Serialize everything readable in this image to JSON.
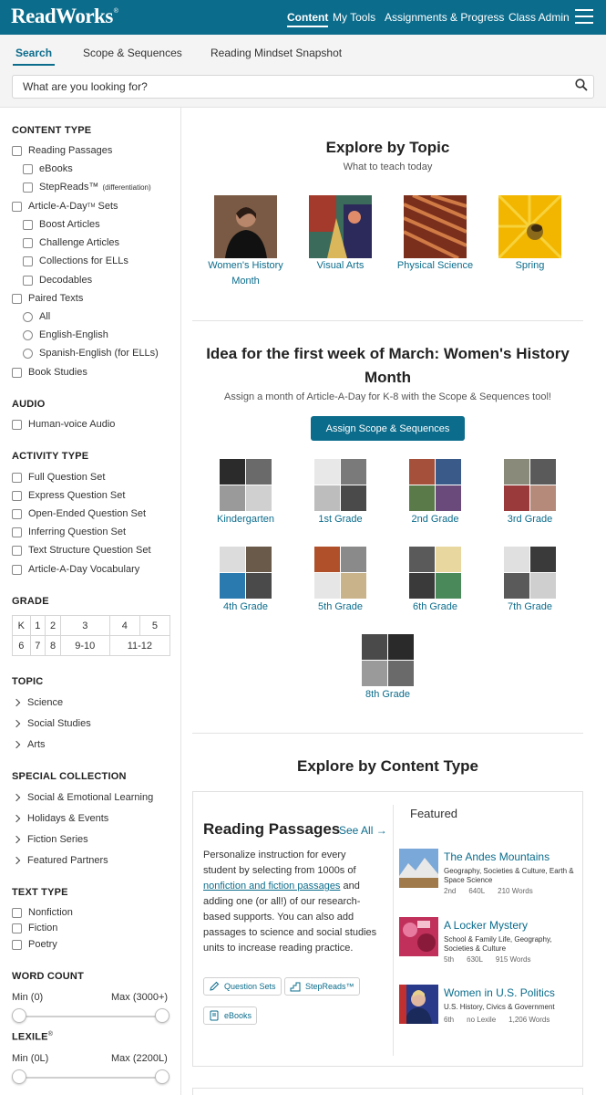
{
  "topbar": {
    "logo": "ReadWorks",
    "logo_mark": "®",
    "nav": [
      "Content",
      "My Tools",
      "Assignments & Progress",
      "Class Admin"
    ]
  },
  "subtabs": [
    "Search",
    "Scope & Sequences",
    "Reading Mindset Snapshot"
  ],
  "search": {
    "placeholder": "What are you looking for?"
  },
  "sidebar": {
    "content_type": {
      "heading": "CONTENT TYPE",
      "reading_passages": "Reading Passages",
      "ebooks": "eBooks",
      "stepreads": "StepReads™",
      "stepreads_note": "(differentiation)",
      "article_a_day": "Article-A-Day",
      "article_a_day_tm": "TM",
      "article_a_day_suffix": " Sets",
      "boost": "Boost Articles",
      "challenge": "Challenge Articles",
      "ells": "Collections for ELLs",
      "decodables": "Decodables",
      "paired": "Paired Texts",
      "all": "All",
      "eng_eng": "English-English",
      "spa_eng": "Spanish-English (for ELLs)",
      "book_studies": "Book Studies"
    },
    "audio": {
      "heading": "AUDIO",
      "human_voice": "Human-voice Audio"
    },
    "activity": {
      "heading": "ACTIVITY TYPE",
      "items": [
        "Full Question Set",
        "Express Question Set",
        "Open-Ended Question Set",
        "Inferring Question Set",
        "Text Structure Question Set",
        "Article-A-Day Vocabulary"
      ]
    },
    "grade": {
      "heading": "GRADE",
      "row1": [
        "K",
        "1",
        "2",
        "3",
        "4",
        "5"
      ],
      "row2": [
        "6",
        "7",
        "8",
        "9-10",
        "11-12"
      ]
    },
    "topic": {
      "heading": "TOPIC",
      "items": [
        "Science",
        "Social Studies",
        "Arts"
      ]
    },
    "special": {
      "heading": "SPECIAL COLLECTION",
      "items": [
        "Social & Emotional Learning",
        "Holidays & Events",
        "Fiction Series",
        "Featured Partners"
      ]
    },
    "text_type": {
      "heading": "TEXT TYPE",
      "items": [
        "Nonfiction",
        "Fiction",
        "Poetry"
      ]
    },
    "word_count": {
      "heading": "WORD COUNT",
      "min": "Min (0)",
      "max": "Max (3000+)"
    },
    "lexile": {
      "heading": "LEXILE",
      "mark": "®",
      "min": "Min (0L)",
      "max": "Max (2200L)"
    }
  },
  "explore_topic": {
    "title": "Explore by Topic",
    "subtitle": "What to teach today",
    "tiles": [
      {
        "label_line1": "Women's History",
        "label_line2": "Month"
      },
      {
        "label_line1": "Visual Arts"
      },
      {
        "label_line1": "Physical Science"
      },
      {
        "label_line1": "Spring"
      }
    ]
  },
  "idea": {
    "title_line1": "Idea for the first week of March: Women's History",
    "title_line2": "Month",
    "subtitle": "Assign a month of Article-A-Day for K-8 with the Scope & Sequences tool!",
    "button": "Assign Scope & Sequences",
    "grades": [
      "Kindergarten",
      "1st Grade",
      "2nd Grade",
      "3rd Grade",
      "4th Grade",
      "5th Grade",
      "6th Grade",
      "7th Grade",
      "8th Grade"
    ]
  },
  "explore_content": {
    "title": "Explore by Content Type",
    "card_title": "Reading Passages",
    "see_all": "See All",
    "desc_1": "Personalize instruction for every",
    "desc_2": "student by selecting from 1000s of",
    "desc_link": "nonfiction and fiction passages",
    "desc_3": " and",
    "desc_4": "adding one (or all!) of our research-",
    "desc_5": "based supports. You can also add",
    "desc_6": "passages to science and social studies",
    "desc_7": "units to increase reading practice.",
    "pills": [
      "Question Sets",
      "StepReads™",
      "eBooks"
    ],
    "featured_heading": "Featured",
    "featured": [
      {
        "title": "The Andes Mountains",
        "meta": "Geography, Societies & Culture, Earth & Space Science",
        "grade": "2nd",
        "lexile": "640L",
        "words": "210 Words"
      },
      {
        "title": "A Locker Mystery",
        "meta": "School & Family Life, Geography, Societies & Culture",
        "grade": "5th",
        "lexile": "630L",
        "words": "915 Words"
      },
      {
        "title": "Women in U.S. Politics",
        "meta": "U.S. History, Civics & Government",
        "grade": "6th",
        "lexile": "no Lexile",
        "words": "1,206 Words"
      }
    ]
  },
  "colors": {
    "brand": "#0b6c8c",
    "nav_bg": "#0b6c8c"
  }
}
